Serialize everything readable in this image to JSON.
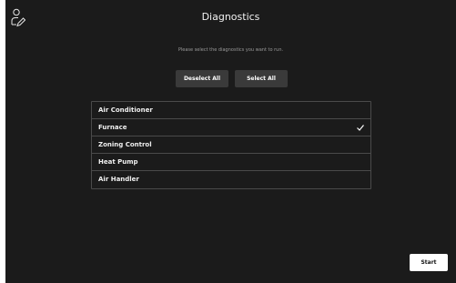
{
  "header": {
    "title": "Diagnostics",
    "user_icon": "user-edit-icon"
  },
  "instructions": "Please select the diagnostics you want to run.",
  "actions": {
    "deselect_all": "Deselect All",
    "select_all": "Select All"
  },
  "diagnostics": [
    {
      "label": "Air Conditioner",
      "selected": false
    },
    {
      "label": "Furnace",
      "selected": true
    },
    {
      "label": "Zoning Control",
      "selected": false
    },
    {
      "label": "Heat Pump",
      "selected": false
    },
    {
      "label": "Air Handler",
      "selected": false
    }
  ],
  "footer": {
    "start_label": "Start"
  },
  "colors": {
    "background": "#1b1b1b",
    "button": "#3a3a3a",
    "border": "#4a4a4a",
    "start_button": "#ffffff"
  }
}
